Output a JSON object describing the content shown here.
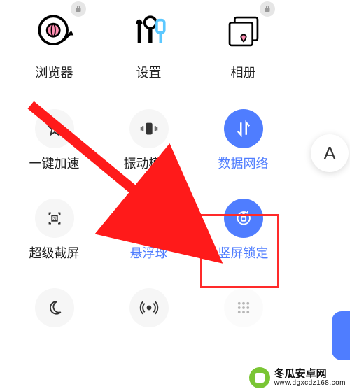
{
  "row1": [
    {
      "label": "浏览器",
      "locked": true
    },
    {
      "label": "设置",
      "locked": false
    },
    {
      "label": "相册",
      "locked": true
    }
  ],
  "row2": [
    {
      "label": "一键加速",
      "icon": "boost-icon",
      "active": false
    },
    {
      "label": "振动模式",
      "icon": "vibrate-icon",
      "active": false
    },
    {
      "label": "数据网络",
      "icon": "data-icon",
      "active": true
    }
  ],
  "row3": [
    {
      "label": "超级截屏",
      "icon": "screenshot-icon",
      "active": false
    },
    {
      "label": "悬浮球",
      "icon": "float-ball-icon",
      "active": true
    },
    {
      "label": "竖屏锁定",
      "icon": "orientation-lock-icon",
      "active": true,
      "highlighted": true
    }
  ],
  "row4_icons": [
    "moon-icon",
    "hotspot-icon",
    "grid-icon"
  ],
  "side_label": "A",
  "watermark": {
    "name": "冬瓜安卓网",
    "url": "www.dgxcdz168.com"
  }
}
